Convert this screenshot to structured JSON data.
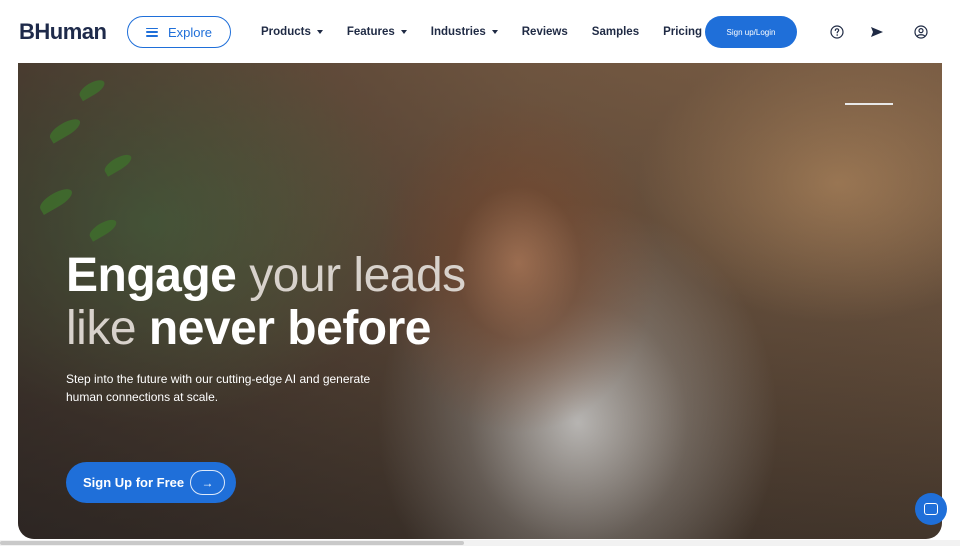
{
  "header": {
    "logo": "BHuman",
    "explore_label": "Explore",
    "nav": [
      {
        "label": "Products",
        "dropdown": true
      },
      {
        "label": "Features",
        "dropdown": true
      },
      {
        "label": "Industries",
        "dropdown": true
      },
      {
        "label": "Reviews",
        "dropdown": false
      },
      {
        "label": "Samples",
        "dropdown": false
      },
      {
        "label": "Pricing",
        "dropdown": false
      }
    ],
    "signup_label": "Sign up/Login",
    "icons": [
      "help-icon",
      "send-icon",
      "user-account-icon"
    ]
  },
  "hero": {
    "title_line1_a": "Engage",
    "title_line1_b": "your leads",
    "title_line2_a": "like",
    "title_line2_b": "never before",
    "subtitle": "Step into the future with our cutting-edge AI and generate human connections at scale.",
    "cta_label": "Sign Up for Free",
    "cta_icon": "arrow-right-icon"
  },
  "chat": {
    "icon": "chat-bubble-icon"
  },
  "colors": {
    "accent": "#1f6fd9",
    "text_dark": "#1f2a44",
    "hero_title_light": "#d8d2cc"
  }
}
